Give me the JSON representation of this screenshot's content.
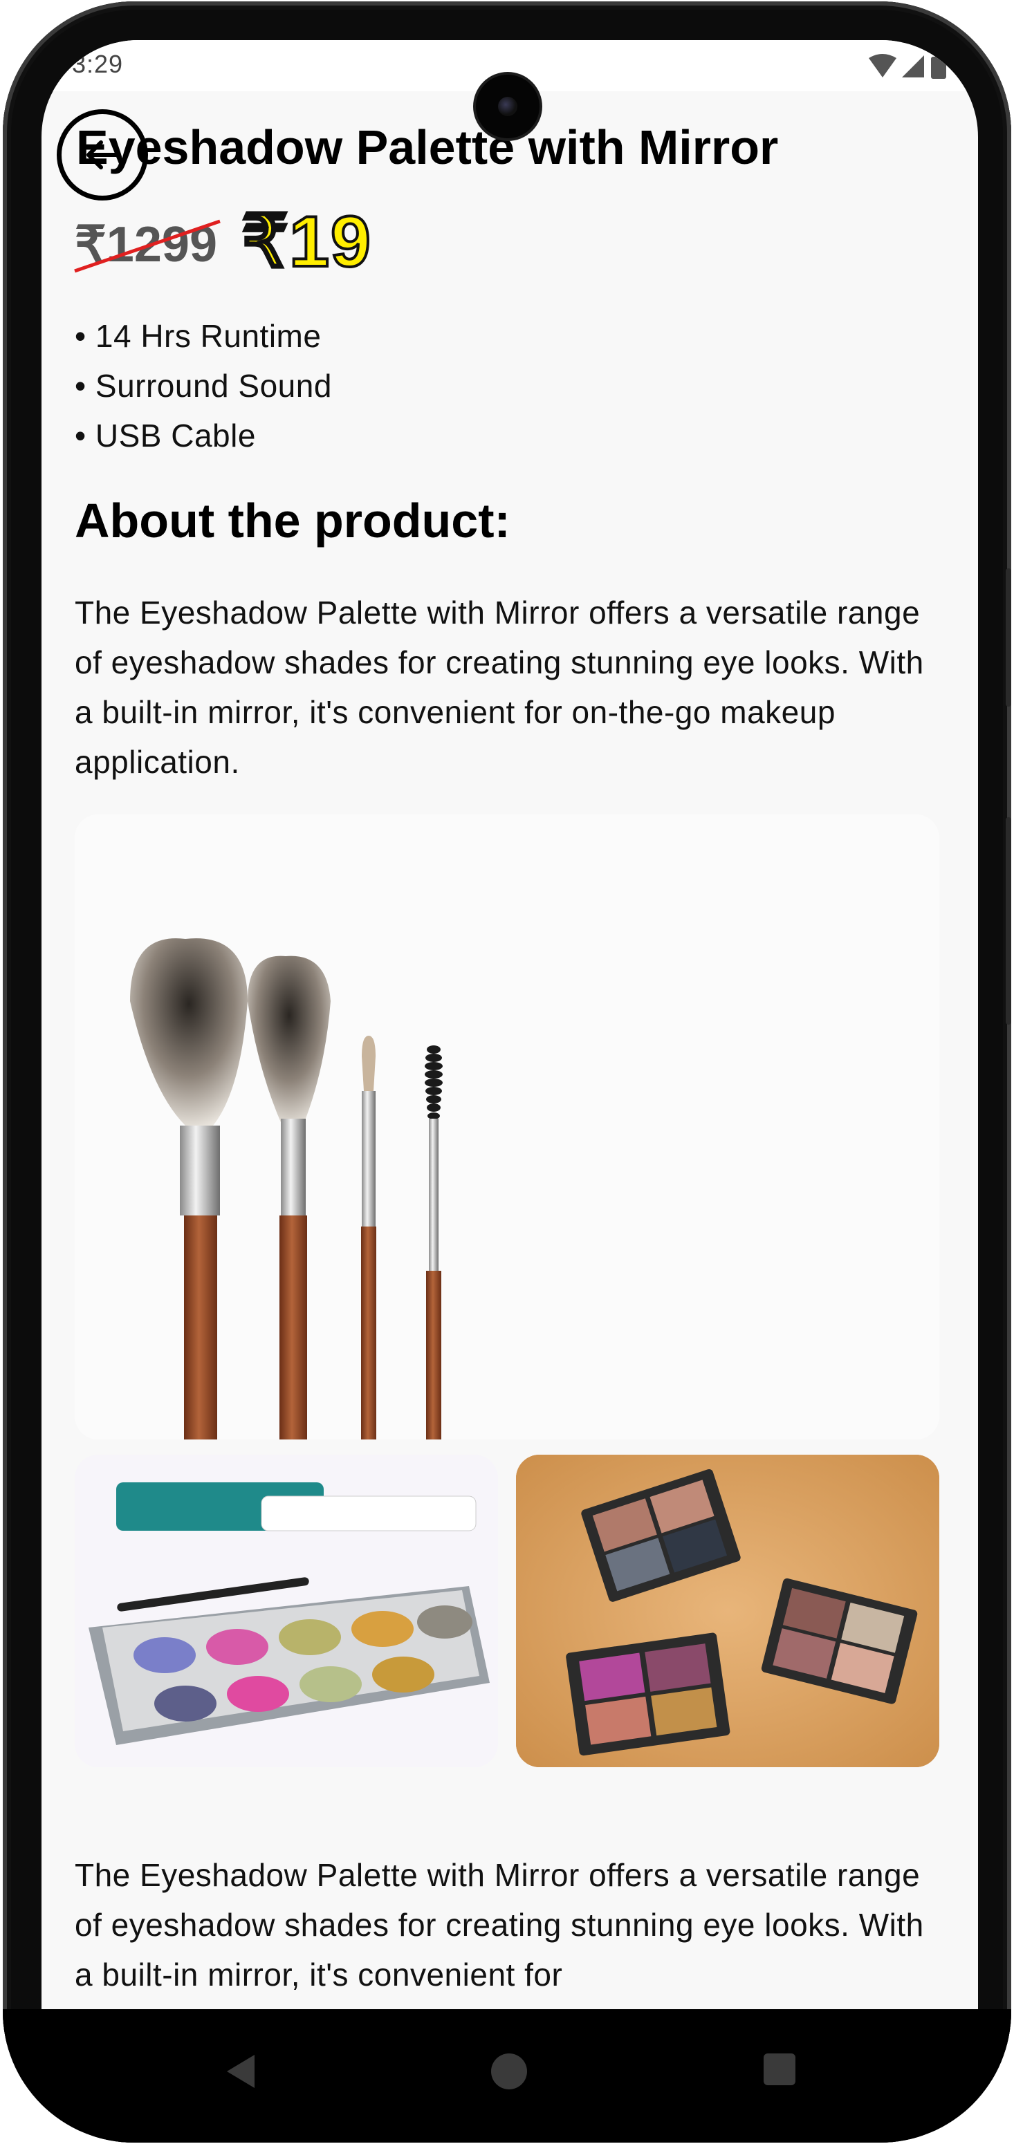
{
  "status": {
    "time": "3:29"
  },
  "product": {
    "title": "Eyeshadow Palette with Mirror",
    "old_price": "₹1299",
    "new_price": "₹19",
    "features": [
      "• 14 Hrs Runtime",
      "• Surround Sound",
      "• USB Cable"
    ],
    "about_heading": "About the product:",
    "description": "The Eyeshadow Palette with Mirror offers a versatile range of eyeshadow shades for creating stunning eye looks. With a built-in mirror, it's convenient for on-the-go makeup application.",
    "description_repeat": "The Eyeshadow Palette with Mirror offers a versatile range of eyeshadow shades for creating stunning eye looks. With a built-in mirror, it's convenient for"
  },
  "images": {
    "main": "makeup-brushes-photo",
    "left": "eyeshadow-palette-photo",
    "right": "eyeshadow-quads-photo"
  },
  "icons": {
    "back": "arrow-left-icon",
    "wifi": "wifi-icon",
    "signal": "signal-icon",
    "battery": "battery-icon",
    "nav_back": "triangle-back-icon",
    "nav_home": "circle-home-icon",
    "nav_recent": "square-recent-icon"
  },
  "colors": {
    "new_price": "#ffee00",
    "strike": "#e02020",
    "background": "#f8f8f8"
  }
}
